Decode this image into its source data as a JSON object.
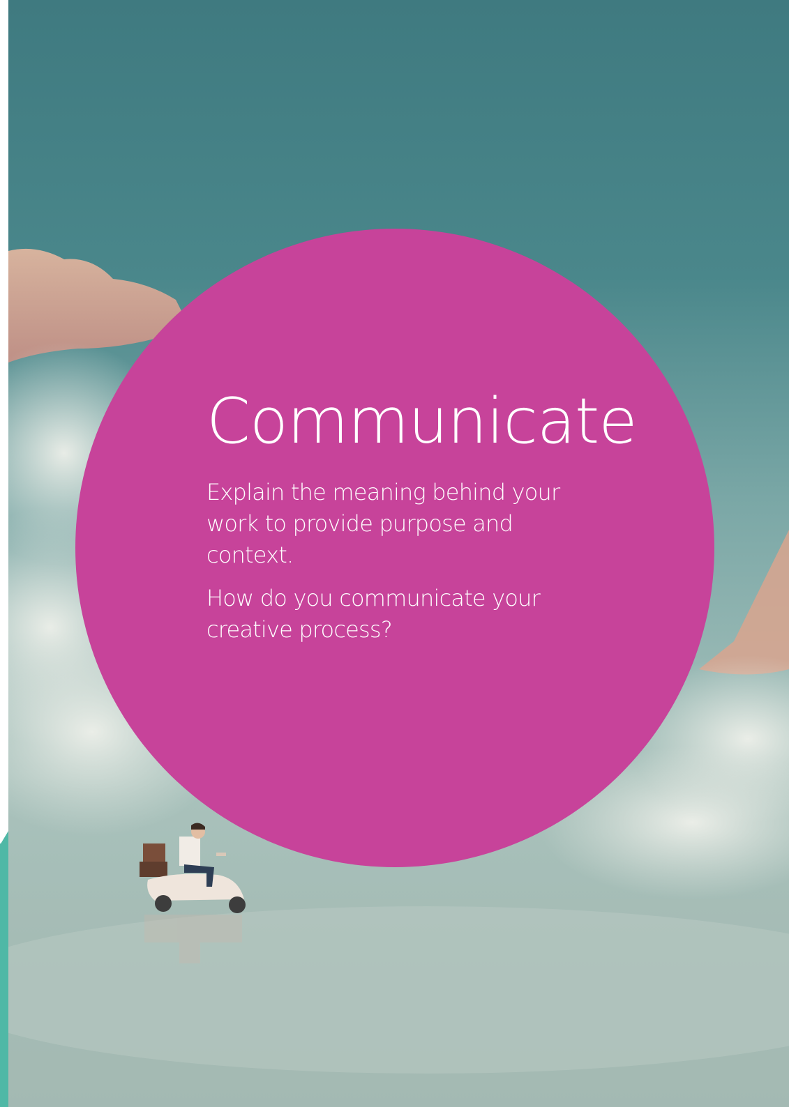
{
  "page": {
    "title": "Communicate",
    "body_paragraphs": [
      "Explain the meaning behind your work to provide purpose and context.",
      "How do you communicate your creative process?"
    ]
  },
  "colors": {
    "circle": "#c7439a",
    "sky_top": "#417b81",
    "accent_strip": "#4fb8a6",
    "text": "#ffffff"
  },
  "icons": {
    "illustration": "scooter-rider-on-clouds"
  }
}
